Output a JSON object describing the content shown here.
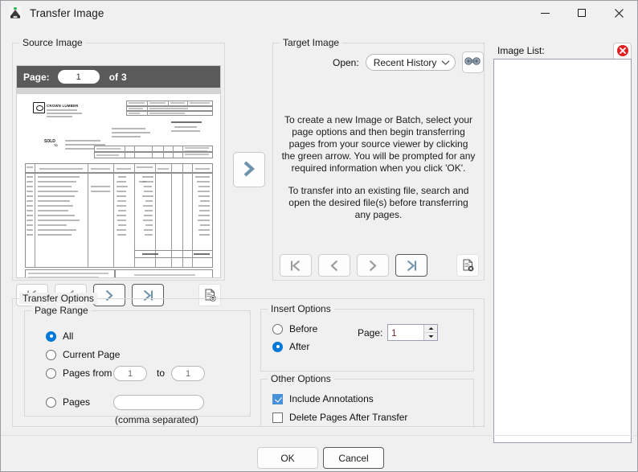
{
  "window": {
    "title": "Transfer Image",
    "icon": "scanner-icon",
    "controls": {
      "minimize": "minimize-icon",
      "maximize": "maximize-icon",
      "close": "close-icon"
    }
  },
  "source": {
    "legend": "Source Image",
    "page_label": "Page:",
    "page_value": "1",
    "of_label": "of",
    "page_count": "3",
    "nav": [
      {
        "name": "first-page-button",
        "glyph": "first",
        "enabled": false
      },
      {
        "name": "previous-page-button",
        "glyph": "prev",
        "enabled": false
      },
      {
        "name": "next-page-button",
        "glyph": "next",
        "enabled": true
      },
      {
        "name": "last-page-button",
        "glyph": "last",
        "enabled": true
      }
    ],
    "add_page_icon": "document-add-icon"
  },
  "transfer": {
    "arrow_icon": "chevron-right-icon"
  },
  "target": {
    "legend": "Target Image",
    "open_label": "Open:",
    "open_value": "Recent History",
    "search_icon": "binoculars-icon",
    "message_1": "To create a new Image or Batch, select your page options and then begin transferring pages from your source viewer by clicking the green arrow. You will be prompted for any required information when you click 'OK'.",
    "message_2": "To transfer into an existing file, search and open the desired file(s) before transferring any pages.",
    "nav": [
      {
        "name": "first-page-button",
        "glyph": "first",
        "enabled": false
      },
      {
        "name": "previous-page-button",
        "glyph": "prev",
        "enabled": false
      },
      {
        "name": "next-page-button",
        "glyph": "next",
        "enabled": false
      },
      {
        "name": "last-page-button",
        "glyph": "last",
        "enabled": true
      }
    ],
    "remove_page_icon": "document-delete-icon"
  },
  "image_list": {
    "label": "Image List:",
    "clear_icon": "red-close-circle-icon",
    "items": []
  },
  "transfer_options": {
    "legend": "Transfer Options",
    "page_range": {
      "legend": "Page Range",
      "options": [
        {
          "label": "All",
          "selected": true
        },
        {
          "label": "Current Page",
          "selected": false
        },
        {
          "label": "Pages from",
          "selected": false
        },
        {
          "label": "Pages",
          "selected": false
        }
      ],
      "from_value": "1",
      "to_label": "to",
      "to_value": "1",
      "pages_value": "",
      "hint": "(comma separated)"
    },
    "insert_options": {
      "legend": "Insert Options",
      "options": [
        {
          "label": "Before",
          "selected": false
        },
        {
          "label": "After",
          "selected": true
        }
      ],
      "page_label": "Page:",
      "page_value": "1"
    },
    "other_options": {
      "legend": "Other Options",
      "checkboxes": [
        {
          "label": "Include Annotations",
          "checked": true
        },
        {
          "label": "Delete Pages After Transfer",
          "checked": false
        }
      ]
    }
  },
  "footer": {
    "ok_label": "OK",
    "cancel_label": "Cancel"
  },
  "colors": {
    "accent": "#0078d7",
    "nav_enabled": "#6f93ad",
    "nav_disabled": "#9a9a9a",
    "pagebar_bg": "#5a5a5a",
    "clear_red": "#e02020",
    "window_bg": "#f0f0f0"
  }
}
